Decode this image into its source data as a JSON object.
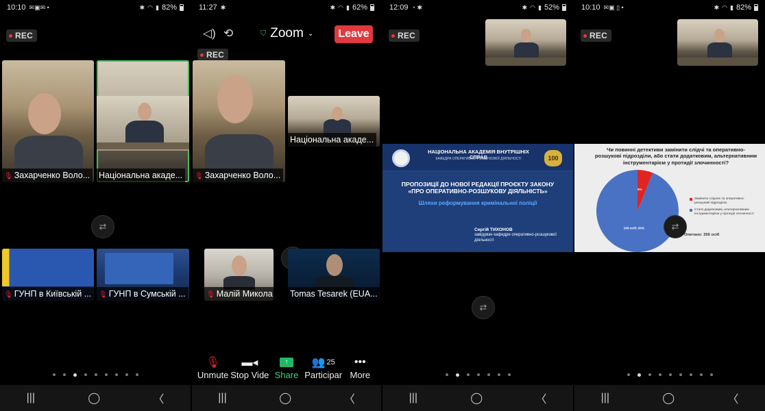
{
  "phones": [
    {
      "status": {
        "time": "10:10",
        "battery": "82%"
      },
      "rec": "REC",
      "tiles": [
        {
          "name": "Захарченко Воло...",
          "muted": true
        },
        {
          "name": "Національна акаде...",
          "muted": false,
          "active": true
        },
        {
          "name": "ГУНП в Київській ...",
          "muted": true
        },
        {
          "name": "ГУНП в Сумській ...",
          "muted": true
        }
      ],
      "page_dots": 9,
      "active_dot": 3
    },
    {
      "status": {
        "time": "11:27",
        "battery": "62%"
      },
      "rec": "REC",
      "meeting_title": "Zoom",
      "leave_label": "Leave",
      "tiles": [
        {
          "name": "Захарченко Воло...",
          "muted": true
        },
        {
          "name": "Національна акаде...",
          "muted": false
        },
        {
          "name": "Малій Микола Іва...",
          "muted": true
        },
        {
          "name": "Tomas Tesarek (EUA...",
          "muted": false
        }
      ],
      "toolbar": {
        "unmute": "Unmute",
        "stop_video": "Stop Vide",
        "share": "Share",
        "participants": "Participar",
        "participants_count": "25",
        "more": "More"
      }
    },
    {
      "status": {
        "time": "12:09",
        "battery": "52%"
      },
      "rec": "REC",
      "slide": {
        "academy": "НАЦІОНАЛЬНА АКАДЕМІЯ ВНУТРІШНІХ СПРАВ",
        "department": "КАФЕДРА ОПЕРАТИВНО-РОЗШУКОВОЇ ДІЯЛЬНОСТІ",
        "badge": "100",
        "title_line1": "ПРОПОЗИЦІЇ ДО НОВОЇ РЕДАКЦІЇ ПРОЄКТУ ЗАКОНУ",
        "title_line2": "«ПРО ОПЕРАТИВНО-РОЗШУКОВУ ДІЯЛЬНІСТЬ»",
        "subtitle": "Шляхи реформування кримінальної поліції",
        "author_name": "Сергій ТИХОНОВ",
        "author_role": "завідувач кафедри оперативно-розшукової діяльності"
      },
      "page_dots": 7,
      "active_dot": 1
    },
    {
      "status": {
        "time": "10:10",
        "battery": "82%"
      },
      "rec": "REC",
      "question": "Чи повинні детективи замінити слідчі та оперативно-розшукові підрозділи, або стати додатковим, альтернативним інструментарієм у протидії злочинності?",
      "chart_data": {
        "type": "pie",
        "title": "Чи повинні детективи замінити слідчі та оперативно-розшукові підрозділи, або стати додатковим, альтернативним інструментарієм у протидії злочинності?",
        "slices": [
          {
            "label": "Замінити слідчих та оперативно-розшукові підрозділи;",
            "value": 16,
            "percent": 6,
            "data_label": "16 осіб; 6%",
            "color": "#e02424"
          },
          {
            "label": "Стати додатковим, альтернативним інструментарієм у протидії злочинності",
            "value": 249,
            "percent": 94,
            "data_label": "249 осіб; 94%",
            "color": "#4a72c4"
          }
        ],
        "note": "Опитано: 265 осіб",
        "legend": "right"
      },
      "page_dots": 9,
      "active_dot": 1
    }
  ],
  "colors": {
    "rec_dot": "#e53935",
    "active_border": "#43c15f",
    "leave": "#e0393e",
    "share": "#1fb86a"
  }
}
